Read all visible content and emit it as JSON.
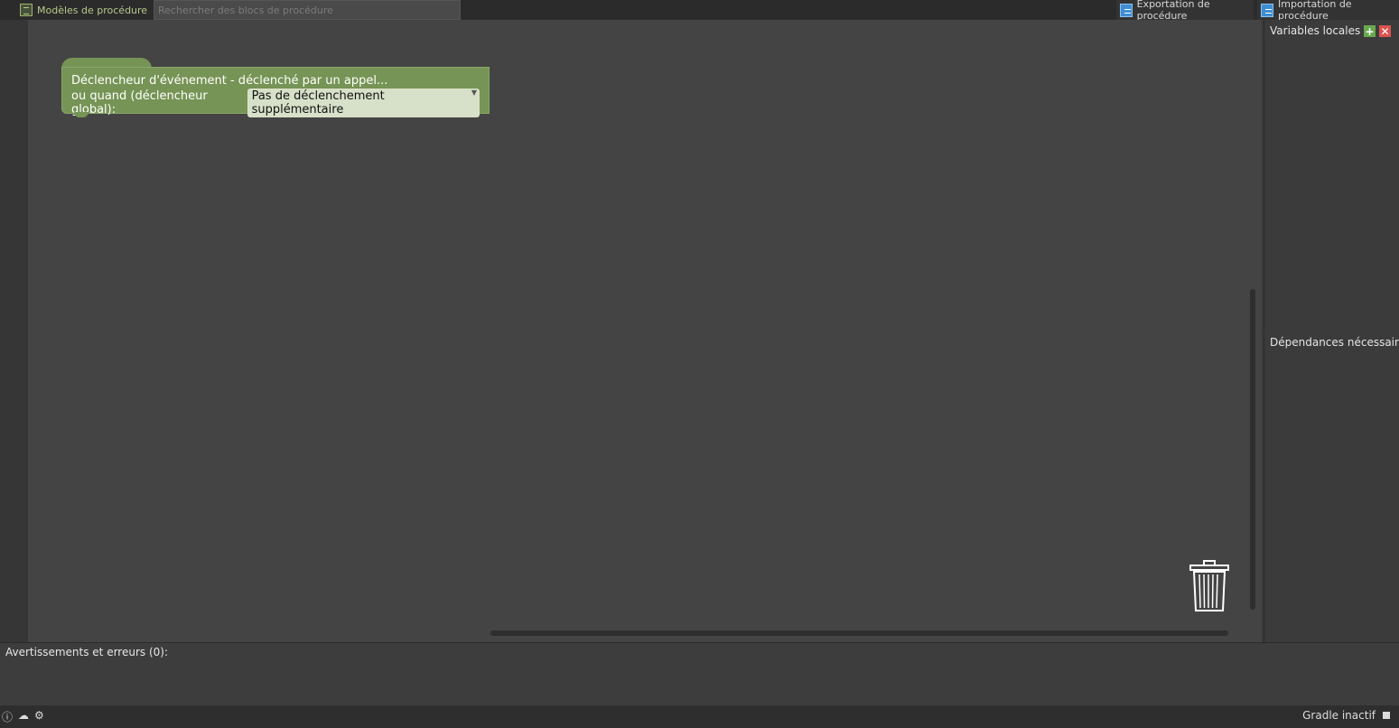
{
  "toolbar": {
    "templates_label": "Modèles de procédure",
    "search_placeholder": "Rechercher des blocs de procédure",
    "export_label": "Exportation de procédure",
    "import_label": "Importation de procédure"
  },
  "block": {
    "line1": "Déclencheur d'événement - déclenché par un appel...",
    "line2_label": "ou quand (déclencheur global):",
    "dropdown_value": "Pas de déclenchement supplémentaire",
    "color": "#769455"
  },
  "right_panel": {
    "local_vars_title": "Variables locales",
    "deps_title": "Dépendances nécessaires"
  },
  "warnings": {
    "title": "Avertissements et erreurs (0):"
  },
  "status": {
    "gradle": "Gradle inactif"
  },
  "icons": {
    "templates": "template-doc-icon",
    "export": "export-icon",
    "import": "import-icon",
    "trash": "trash-icon",
    "add": "plus-icon",
    "remove": "close-icon",
    "info": "info-icon",
    "gradle": "gradle-elephant-icon",
    "settings": "gear-icon",
    "stop": "stop-icon"
  }
}
